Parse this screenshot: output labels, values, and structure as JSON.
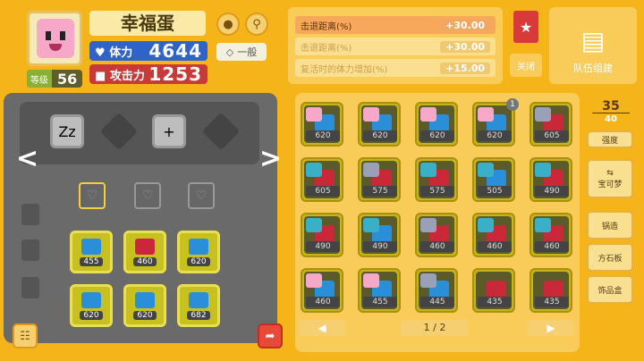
{
  "pokemon": {
    "name": "幸福蛋",
    "level_label": "等级",
    "level": "56",
    "hp_label": "体力",
    "hp": "4644",
    "atk_label": "攻击力",
    "atk": "1253",
    "type_label": "一般"
  },
  "bonuses": [
    {
      "label": "击退距离(%)",
      "value": "+30.00",
      "active": true
    },
    {
      "label": "击退距离(%)",
      "value": "+30.00",
      "active": false
    },
    {
      "label": "复活时的体力增加(%)",
      "value": "+15.00",
      "active": false
    }
  ],
  "buttons": {
    "close": "关闭",
    "team_build": "队伍组建",
    "strength": "强度",
    "pokemon": "宝可梦",
    "cook": "锅造",
    "stone_board": "方石板",
    "decor_box": "饰品盒"
  },
  "count": {
    "current": "35",
    "max": "40"
  },
  "pagination": "1 / 2",
  "equipped_stones": [
    {
      "color": "blue",
      "value": "455"
    },
    {
      "color": "red",
      "value": "460"
    },
    {
      "color": "blue",
      "value": "620"
    },
    {
      "color": "blue",
      "value": "620"
    },
    {
      "color": "blue",
      "value": "620"
    },
    {
      "color": "blue",
      "value": "682"
    }
  ],
  "stone_grid": [
    {
      "pk": "pink",
      "gem": "blue",
      "value": "620"
    },
    {
      "pk": "pink",
      "gem": "blue",
      "value": "620"
    },
    {
      "pk": "pink",
      "gem": "blue",
      "value": "620"
    },
    {
      "pk": "pink",
      "gem": "blue",
      "value": "620",
      "badge": "1"
    },
    {
      "pk": "grey",
      "gem": "red",
      "value": "605"
    },
    {
      "pk": "teal",
      "gem": "red",
      "value": "605"
    },
    {
      "pk": "grey",
      "gem": "red",
      "value": "575"
    },
    {
      "pk": "teal",
      "gem": "red",
      "value": "575"
    },
    {
      "pk": "teal",
      "gem": "blue",
      "value": "505"
    },
    {
      "pk": "teal",
      "gem": "red",
      "value": "490"
    },
    {
      "pk": "teal",
      "gem": "red",
      "value": "490"
    },
    {
      "pk": "teal",
      "gem": "blue",
      "value": "490"
    },
    {
      "pk": "grey",
      "gem": "red",
      "value": "460"
    },
    {
      "pk": "teal",
      "gem": "red",
      "value": "460"
    },
    {
      "pk": "teal",
      "gem": "red",
      "value": "460"
    },
    {
      "pk": "pink",
      "gem": "blue",
      "value": "460"
    },
    {
      "pk": "pink",
      "gem": "blue",
      "value": "455"
    },
    {
      "pk": "grey",
      "gem": "blue",
      "value": "445"
    },
    {
      "pk": "none",
      "gem": "red",
      "value": "435"
    },
    {
      "pk": "none",
      "gem": "red",
      "value": "435"
    }
  ],
  "colors": {
    "blue": "#2a8ed8",
    "red": "#c82838",
    "pink": "#f7a8c8",
    "teal": "#3ab0c8",
    "grey": "#9aa0b8",
    "accent": "#f4b41a"
  }
}
